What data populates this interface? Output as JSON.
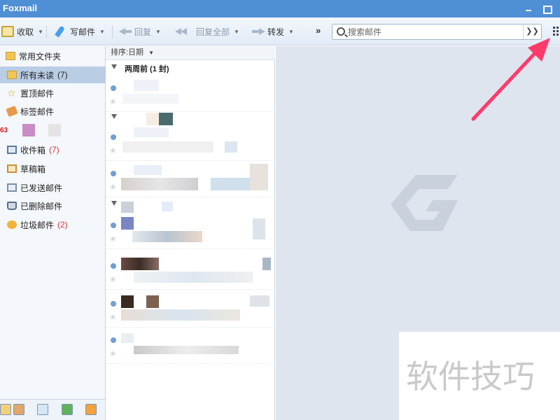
{
  "window": {
    "title": "Foxmail"
  },
  "toolbar": {
    "receive_label": "收取",
    "write_label": "写邮件",
    "reply_label": "回复",
    "reply_all_label": "回复全部",
    "forward_label": "转发",
    "more_label": "»",
    "search_placeholder": "搜索邮件"
  },
  "sidebar": {
    "header_label": "常用文件夹",
    "items": [
      {
        "label": "所有未读",
        "count": "(7)",
        "icon": "folder-icon"
      },
      {
        "label": "置顶邮件",
        "count": "",
        "icon": "star-icon"
      },
      {
        "label": "标签邮件",
        "count": "",
        "icon": "tag-icon"
      },
      {
        "label": "收件箱",
        "count": "(7)",
        "icon": "inbox-icon"
      },
      {
        "label": "草稿箱",
        "count": "",
        "icon": "draft-icon"
      },
      {
        "label": "已发送邮件",
        "count": "",
        "icon": "sent-icon"
      },
      {
        "label": "已删除邮件",
        "count": "",
        "icon": "trash-icon"
      },
      {
        "label": "垃圾邮件",
        "count": "(2)",
        "icon": "junk-icon"
      }
    ],
    "account_prefix": "63"
  },
  "maillist": {
    "sort_label": "排序:日期",
    "group_label": "两周前 (1 封)"
  },
  "watermark": {
    "text": "软件技巧"
  },
  "colors": {
    "titlebar": "#4f8fd6",
    "selected_folder": "#b9cde5",
    "unread_count": "#d63a3a",
    "arrow": "#ff3b6b"
  }
}
